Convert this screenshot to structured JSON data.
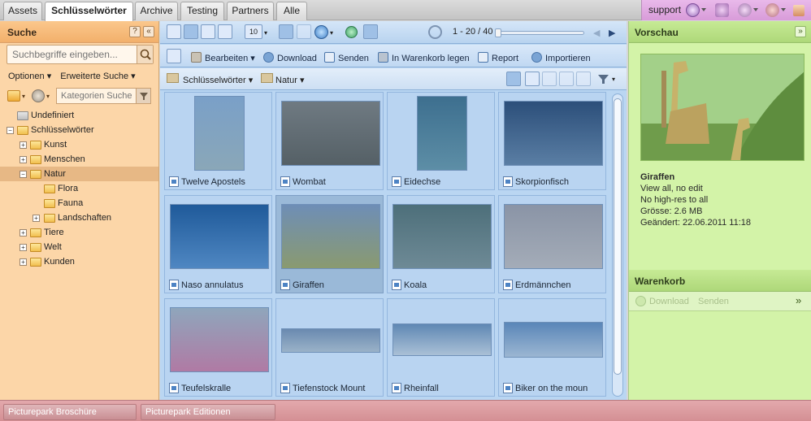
{
  "tabs": [
    "Assets",
    "Schlüsselwörter",
    "Archive",
    "Testing",
    "Partners",
    "Alle"
  ],
  "topbar": {
    "support_label": "support",
    "icons": [
      "help-icon",
      "sync-icon",
      "settings-icon",
      "user-icon",
      "key-icon"
    ]
  },
  "search_panel": {
    "title": "Suche",
    "search_placeholder": "Suchbegriffe eingeben...",
    "options_label": "Optionen",
    "advanced_label": "Erweiterte Suche",
    "category_placeholder": "Kategorien Suche"
  },
  "tree": [
    {
      "label": "Undefiniert",
      "level": 0,
      "expander": ""
    },
    {
      "label": "Schlüsselwörter",
      "level": 0,
      "expander": "−"
    },
    {
      "label": "Kunst",
      "level": 1,
      "expander": "+"
    },
    {
      "label": "Menschen",
      "level": 1,
      "expander": "+"
    },
    {
      "label": "Natur",
      "level": 1,
      "expander": "−",
      "selected": true
    },
    {
      "label": "Flora",
      "level": 2,
      "expander": ""
    },
    {
      "label": "Fauna",
      "level": 2,
      "expander": ""
    },
    {
      "label": "Landschaften",
      "level": 2,
      "expander": "+"
    },
    {
      "label": "Tiere",
      "level": 1,
      "expander": "+"
    },
    {
      "label": "Welt",
      "level": 1,
      "expander": "+"
    },
    {
      "label": "Kunden",
      "level": 1,
      "expander": "+"
    }
  ],
  "toolbar": {
    "view_size": "10",
    "pager": "1 - 20 / 40",
    "actions": [
      "Bearbeiten",
      "Download",
      "Senden",
      "In Warenkorb legen",
      "Report",
      "Importieren"
    ]
  },
  "breadcrumb": [
    "Schlüsselwörter",
    "Natur"
  ],
  "assets": [
    {
      "name": "Twelve Apostels",
      "c1": "#7aa0c8",
      "c2": "#8aa7b8"
    },
    {
      "name": "Wombat",
      "c1": "#6f7a82",
      "c2": "#556066"
    },
    {
      "name": "Eidechse",
      "c1": "#3d6f8f",
      "c2": "#5d8ea6"
    },
    {
      "name": "Skorpionfisch",
      "c1": "#2c4f7a",
      "c2": "#5a7ea4"
    },
    {
      "name": "Naso annulatus",
      "c1": "#1f5a9a",
      "c2": "#4f87c2"
    },
    {
      "name": "Giraffen",
      "c1": "#6e8eb6",
      "c2": "#8a9a70",
      "selected": true
    },
    {
      "name": "Koala",
      "c1": "#4d6f7a",
      "c2": "#6e8a96"
    },
    {
      "name": "Erdmännchen",
      "c1": "#8a94a6",
      "c2": "#a4acb8"
    },
    {
      "name": "Teufelskralle",
      "c1": "#8fa6bc",
      "c2": "#b07aa4"
    },
    {
      "name": "Tiefenstock Mount",
      "c1": "#6a8ab0",
      "c2": "#9ab2c8"
    },
    {
      "name": "Rheinfall",
      "c1": "#5f88b4",
      "c2": "#aac0d6"
    },
    {
      "name": "Biker on the moun",
      "c1": "#5a86b8",
      "c2": "#9bb6d2"
    }
  ],
  "preview": {
    "title": "Vorschau",
    "name": "Giraffen",
    "lines": [
      "View all, no edit",
      "No high-res to all",
      "Grösse: 2.6 MB",
      "Geändert: 22.06.2011 11:18"
    ]
  },
  "cart": {
    "title": "Warenkorb",
    "download_label": "Download",
    "send_label": "Senden"
  },
  "bottom_tabs": [
    "Picturepark Broschüre",
    "Picturepark Editionen"
  ]
}
